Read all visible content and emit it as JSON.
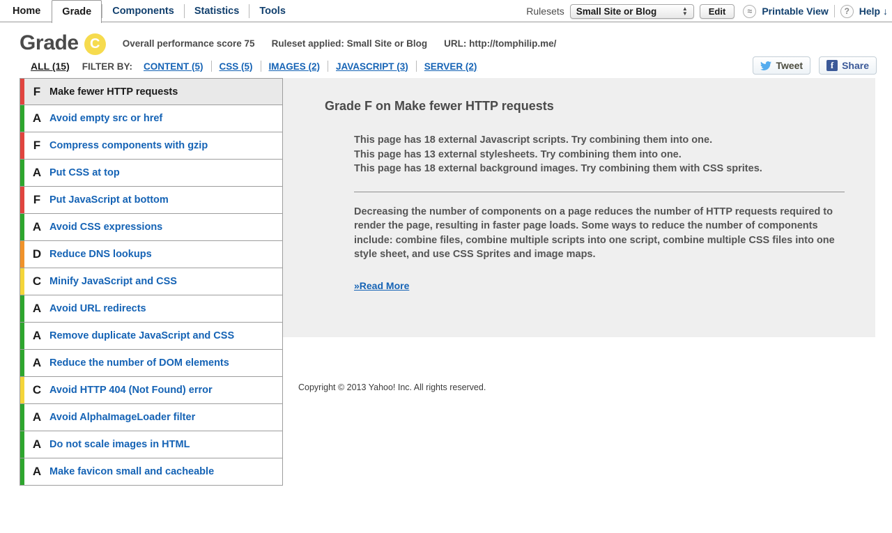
{
  "nav": {
    "tabs": [
      {
        "label": "Home",
        "active": false
      },
      {
        "label": "Grade",
        "active": true
      },
      {
        "label": "Components",
        "active": false
      },
      {
        "label": "Statistics",
        "active": false
      },
      {
        "label": "Tools",
        "active": false
      }
    ],
    "rulesets_label": "Rulesets",
    "ruleset_selected": "Small Site or Blog",
    "ruleset_options": [
      "Small Site or Blog"
    ],
    "edit_label": "Edit",
    "printable_view_label": "Printable View",
    "printable_view_icon": "approximately-equal-icon",
    "help_label": "Help ↓",
    "help_icon": "question-mark-icon"
  },
  "grade_header": {
    "title": "Grade",
    "badge_letter": "C",
    "badge_color": "#f6db4e",
    "score_text": "Overall performance score 75",
    "ruleset_text": "Ruleset applied: Small Site or Blog",
    "url_text": "URL: http://tomphilip.me/"
  },
  "filter_bar": {
    "all_label": "ALL (15)",
    "filter_by_label": "FILTER BY:",
    "filters": [
      {
        "label": "CONTENT (5)"
      },
      {
        "label": "CSS (5)"
      },
      {
        "label": "IMAGES (2)"
      },
      {
        "label": "JAVASCRIPT (3)"
      },
      {
        "label": "SERVER (2)"
      }
    ]
  },
  "social": {
    "tweet_label": "Tweet",
    "tweet_icon": "twitter-bird-icon",
    "share_label": "Share",
    "share_icon": "facebook-f-icon"
  },
  "grade_colors": {
    "A": "#2ea62e",
    "B": "#8dc63f",
    "C": "#f4d53a",
    "D": "#f0922b",
    "F": "#e0453f"
  },
  "rules": [
    {
      "grade": "F",
      "name": "Make fewer HTTP requests",
      "selected": true
    },
    {
      "grade": "A",
      "name": "Avoid empty src or href",
      "selected": false
    },
    {
      "grade": "F",
      "name": "Compress components with gzip",
      "selected": false
    },
    {
      "grade": "A",
      "name": "Put CSS at top",
      "selected": false
    },
    {
      "grade": "F",
      "name": "Put JavaScript at bottom",
      "selected": false
    },
    {
      "grade": "A",
      "name": "Avoid CSS expressions",
      "selected": false
    },
    {
      "grade": "D",
      "name": "Reduce DNS lookups",
      "selected": false
    },
    {
      "grade": "C",
      "name": "Minify JavaScript and CSS",
      "selected": false
    },
    {
      "grade": "A",
      "name": "Avoid URL redirects",
      "selected": false
    },
    {
      "grade": "A",
      "name": "Remove duplicate JavaScript and CSS",
      "selected": false
    },
    {
      "grade": "A",
      "name": "Reduce the number of DOM elements",
      "selected": false
    },
    {
      "grade": "C",
      "name": "Avoid HTTP 404 (Not Found) error",
      "selected": false
    },
    {
      "grade": "A",
      "name": "Avoid AlphaImageLoader filter",
      "selected": false
    },
    {
      "grade": "A",
      "name": "Do not scale images in HTML",
      "selected": false
    },
    {
      "grade": "A",
      "name": "Make favicon small and cacheable",
      "selected": false
    }
  ],
  "detail": {
    "title": "Grade F on Make fewer HTTP requests",
    "findings": "This page has 18 external Javascript scripts. Try combining them into one.\nThis page has 13 external stylesheets. Try combining them into one.\nThis page has 18 external background images. Try combining them with CSS sprites.",
    "description": "Decreasing the number of components on a page reduces the number of HTTP requests required to render the page, resulting in faster page loads. Some ways to reduce the number of components include: combine files, combine multiple scripts into one script, combine multiple CSS files into one style sheet, and use CSS Sprites and image maps.",
    "read_more_label": "»Read More"
  },
  "footer": {
    "copyright": "Copyright © 2013 Yahoo! Inc. All rights reserved."
  }
}
